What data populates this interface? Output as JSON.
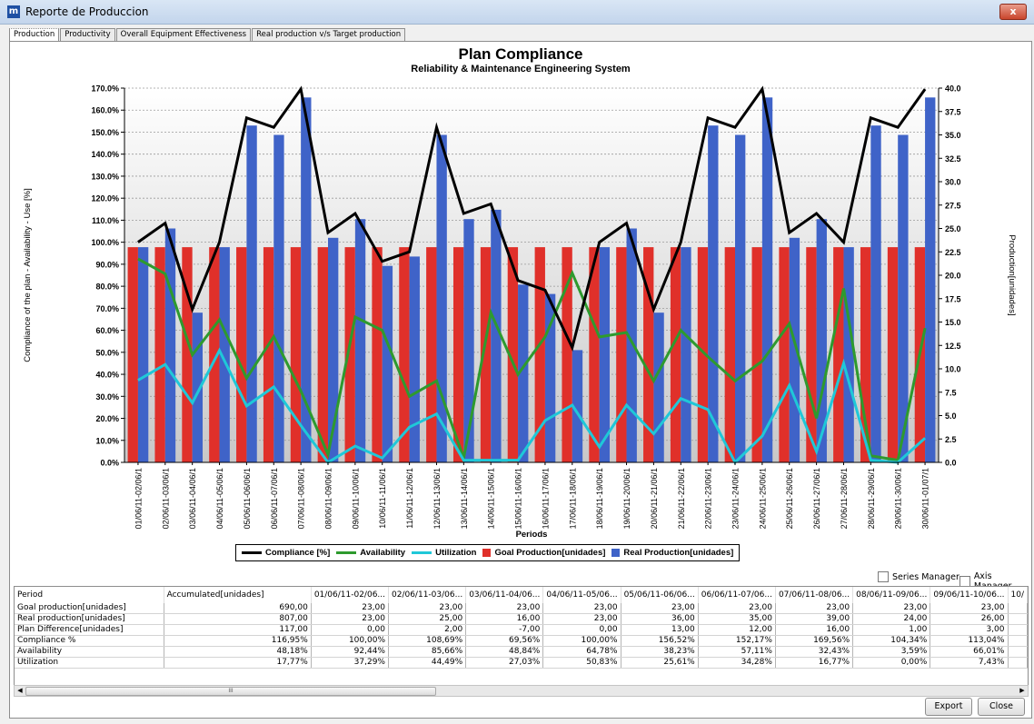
{
  "window": {
    "title": "Reporte de Produccion",
    "icon_letter": "m",
    "close_glyph": "x"
  },
  "tabs": [
    "Production",
    "Productivity",
    "Overall Equipment Effectiveness",
    "Real production v/s Target production"
  ],
  "chart_data": {
    "type": "bar",
    "title": "Plan Compliance",
    "subtitle": "Reliability & Maintenance Engineering System",
    "xlabel": "Periods",
    "ylabel_left": "Compliance of the plan - Availability - Use [%]",
    "ylabel_right": "Production[unidades]",
    "ylim_left": [
      0,
      170
    ],
    "ylim_right": [
      0,
      40
    ],
    "left_ticks": [
      "0.0%",
      "10.0%",
      "20.0%",
      "30.0%",
      "40.0%",
      "50.0%",
      "60.0%",
      "70.0%",
      "80.0%",
      "90.0%",
      "100.0%",
      "110.0%",
      "120.0%",
      "130.0%",
      "140.0%",
      "150.0%",
      "160.0%",
      "170.0%"
    ],
    "right_ticks": [
      "0.0",
      "2.5",
      "5.0",
      "7.5",
      "10.0",
      "12.5",
      "15.0",
      "17.5",
      "20.0",
      "22.5",
      "25.0",
      "27.5",
      "30.0",
      "32.5",
      "35.0",
      "37.5",
      "40.0"
    ],
    "grid": true,
    "categories": [
      "01/06/11-02/06/1",
      "02/06/11-03/06/1",
      "03/06/11-04/06/1",
      "04/06/11-05/06/1",
      "05/06/11-06/06/1",
      "06/06/11-07/06/1",
      "07/06/11-08/06/1",
      "08/06/11-09/06/1",
      "09/06/11-10/06/1",
      "10/06/11-11/06/1",
      "11/06/11-12/06/1",
      "12/06/11-13/06/1",
      "13/06/11-14/06/1",
      "14/06/11-15/06/1",
      "15/06/11-16/06/1",
      "16/06/11-17/06/1",
      "17/06/11-18/06/1",
      "18/06/11-19/06/1",
      "19/06/11-20/06/1",
      "20/06/11-21/06/1",
      "21/06/11-22/06/1",
      "22/06/11-23/06/1",
      "23/06/11-24/06/1",
      "24/06/11-25/06/1",
      "25/06/11-26/06/1",
      "26/06/11-27/06/1",
      "27/06/11-28/06/1",
      "28/06/11-29/06/1",
      "29/06/11-30/06/1",
      "30/06/11-01/07/1"
    ],
    "series": [
      {
        "name": "Compliance [%]",
        "type": "line",
        "axis": "left",
        "color": "#000000",
        "values": [
          100.0,
          108.69,
          69.56,
          100.0,
          156.52,
          152.17,
          169.56,
          104.34,
          113.04,
          91.3,
          95.65,
          152.17,
          113.04,
          117.39,
          82.6,
          78.26,
          52.17,
          100.0,
          108.69,
          69.56,
          100.0,
          156.52,
          152.17,
          169.56,
          104.34,
          113.04,
          100.0,
          156.52,
          152.17,
          169.56
        ]
      },
      {
        "name": "Availability",
        "type": "line",
        "axis": "left",
        "color": "#2e9a2e",
        "values": [
          92.44,
          85.66,
          48.84,
          64.78,
          38.23,
          57.11,
          32.43,
          3.59,
          66.01,
          60.0,
          30.0,
          37.0,
          2.0,
          68.0,
          40.0,
          57.0,
          86.0,
          57.0,
          59.0,
          37.0,
          60.0,
          48.0,
          37.0,
          46.0,
          63.0,
          20.0,
          79.0,
          3.0,
          1.0,
          61.0
        ]
      },
      {
        "name": "Utilization",
        "type": "line",
        "axis": "left",
        "color": "#1fc8d8",
        "values": [
          37.29,
          44.49,
          27.03,
          50.83,
          25.61,
          34.28,
          16.77,
          0.0,
          7.43,
          2.0,
          16.0,
          22.0,
          1.0,
          1.0,
          1.0,
          19.0,
          26.0,
          7.0,
          26.0,
          13.0,
          29.0,
          24.0,
          0.0,
          12.0,
          35.0,
          5.0,
          45.0,
          1.0,
          0.0,
          11.0
        ]
      },
      {
        "name": "Goal Production[unidades]",
        "type": "bar",
        "axis": "right",
        "color": "#e0302a",
        "values": [
          23,
          23,
          23,
          23,
          23,
          23,
          23,
          23,
          23,
          23,
          23,
          23,
          23,
          23,
          23,
          23,
          23,
          23,
          23,
          23,
          23,
          23,
          23,
          23,
          23,
          23,
          23,
          23,
          23,
          23
        ]
      },
      {
        "name": "Real Production[unidades]",
        "type": "bar",
        "axis": "right",
        "color": "#3f63c8",
        "values": [
          23,
          25,
          16,
          23,
          36,
          35,
          39,
          24,
          26,
          21,
          22,
          35,
          26,
          27,
          19,
          18,
          12,
          23,
          25,
          16,
          23,
          36,
          35,
          39,
          24,
          26,
          23,
          36,
          35,
          39
        ]
      }
    ]
  },
  "managers": {
    "series": "Series Manager",
    "axis": "Axis Manager"
  },
  "table": {
    "headers": [
      "Period",
      "Accumulated[unidades]",
      "01/06/11-02/06...",
      "02/06/11-03/06...",
      "03/06/11-04/06...",
      "04/06/11-05/06...",
      "05/06/11-06/06...",
      "06/06/11-07/06...",
      "07/06/11-08/06...",
      "08/06/11-09/06...",
      "09/06/11-10/06...",
      "10/"
    ],
    "rows": [
      [
        "Goal production[unidades]",
        "690,00",
        "23,00",
        "23,00",
        "23,00",
        "23,00",
        "23,00",
        "23,00",
        "23,00",
        "23,00",
        "23,00"
      ],
      [
        "Real production[unidades]",
        "807,00",
        "23,00",
        "25,00",
        "16,00",
        "23,00",
        "36,00",
        "35,00",
        "39,00",
        "24,00",
        "26,00"
      ],
      [
        "Plan Difference[unidades]",
        "117,00",
        "0,00",
        "2,00",
        "-7,00",
        "0,00",
        "13,00",
        "12,00",
        "16,00",
        "1,00",
        "3,00"
      ],
      [
        "Compliance %",
        "116,95%",
        "100,00%",
        "108,69%",
        "69,56%",
        "100,00%",
        "156,52%",
        "152,17%",
        "169,56%",
        "104,34%",
        "113,04%"
      ],
      [
        "Availability",
        "48,18%",
        "92,44%",
        "85,66%",
        "48,84%",
        "64,78%",
        "38,23%",
        "57,11%",
        "32,43%",
        "3,59%",
        "66,01%"
      ],
      [
        "Utilization",
        "17,77%",
        "37,29%",
        "44,49%",
        "27,03%",
        "50,83%",
        "25,61%",
        "34,28%",
        "16,77%",
        "0,00%",
        "7,43%"
      ]
    ]
  },
  "scroll": {
    "left": "◀",
    "right": "▶",
    "thumb": "III"
  },
  "buttons": {
    "export": "Export",
    "close": "Close"
  }
}
